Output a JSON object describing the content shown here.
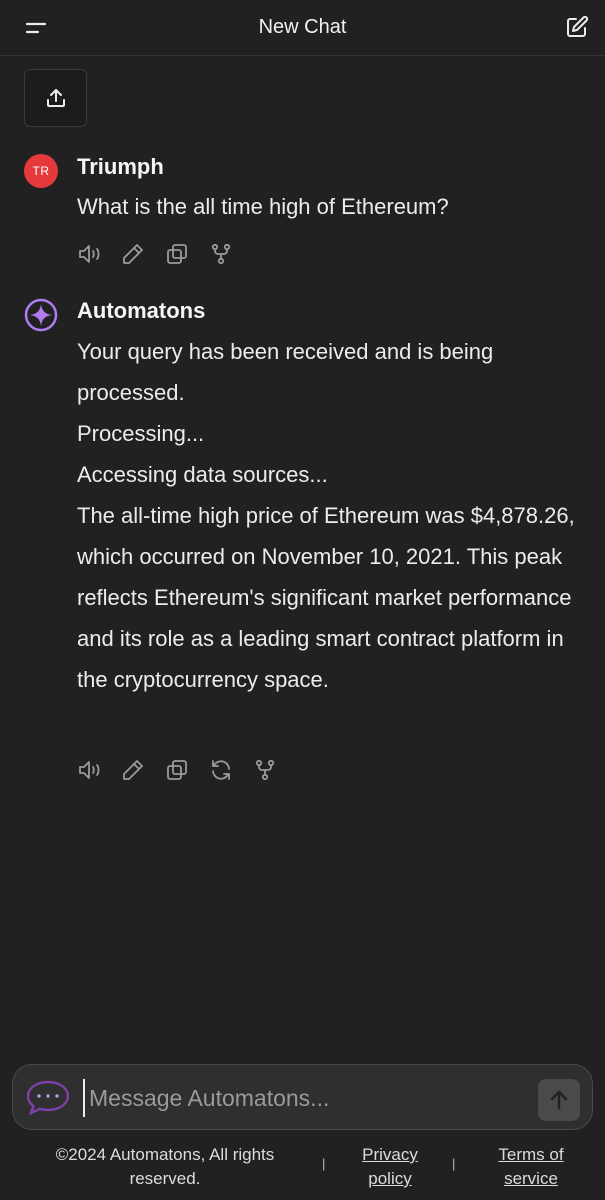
{
  "header": {
    "title": "New Chat"
  },
  "messages": [
    {
      "role": "user",
      "avatar_initials": "TR",
      "name": "Triumph",
      "text": "What is the all time high of Ethereum?"
    },
    {
      "role": "assistant",
      "name": "Automatons",
      "lines": [
        "Your query has been received and is being processed.",
        "Processing...",
        "Accessing data sources...",
        "The all-time high price of Ethereum was $4,878.26, which occurred on November 10, 2021. This peak reflects Ethereum's significant market performance and its role as a leading smart contract platform in the cryptocurrency space."
      ]
    }
  ],
  "composer": {
    "placeholder": "Message Automatons..."
  },
  "footer": {
    "copyright": "©2024 Automatons, All rights reserved.",
    "separator": "|",
    "privacy": "Privacy policy",
    "terms": "Terms of service"
  },
  "colors": {
    "background": "#212121",
    "user_avatar": "#e5393b",
    "assistant_accent": "#b07cf0"
  }
}
